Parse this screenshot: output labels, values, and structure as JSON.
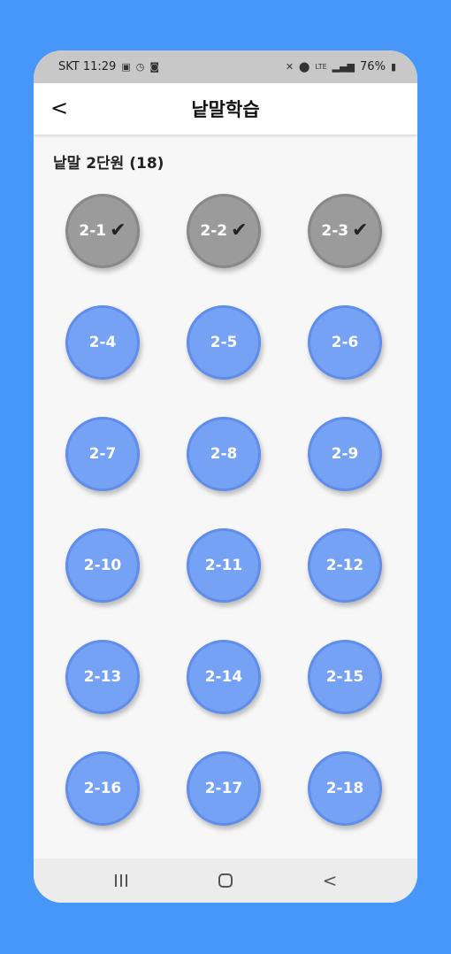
{
  "status": {
    "carrier_time": "SKT 11:29",
    "left_icons": [
      "image-icon",
      "alarm-icon",
      "notification-icon"
    ],
    "right_text": "76%",
    "network": "LTE"
  },
  "app_bar": {
    "title": "낱말학습"
  },
  "section": {
    "title": "낱말 2단원 (18)"
  },
  "colors": {
    "completed": "#9b9b9b",
    "pending": "#76a2f6",
    "background": "#4797fb"
  },
  "lessons": [
    {
      "label": "2-1",
      "done": true
    },
    {
      "label": "2-2",
      "done": true
    },
    {
      "label": "2-3",
      "done": true
    },
    {
      "label": "2-4",
      "done": false
    },
    {
      "label": "2-5",
      "done": false
    },
    {
      "label": "2-6",
      "done": false
    },
    {
      "label": "2-7",
      "done": false
    },
    {
      "label": "2-8",
      "done": false
    },
    {
      "label": "2-9",
      "done": false
    },
    {
      "label": "2-10",
      "done": false
    },
    {
      "label": "2-11",
      "done": false
    },
    {
      "label": "2-12",
      "done": false
    },
    {
      "label": "2-13",
      "done": false
    },
    {
      "label": "2-14",
      "done": false
    },
    {
      "label": "2-15",
      "done": false
    },
    {
      "label": "2-16",
      "done": false
    },
    {
      "label": "2-17",
      "done": false
    },
    {
      "label": "2-18",
      "done": false
    }
  ],
  "check_glyph": "✔",
  "nav": {
    "back_glyph": "<"
  }
}
